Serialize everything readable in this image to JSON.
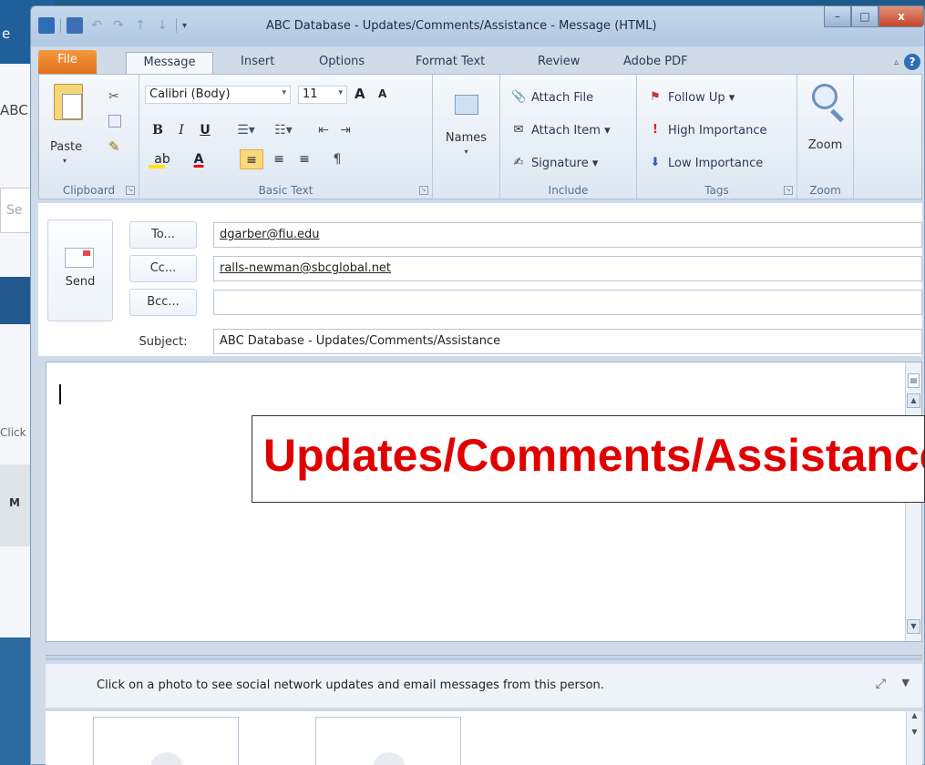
{
  "background_app": {
    "top_text": "e",
    "left_text": "ABC",
    "search_text": "Se",
    "click_text": "Click",
    "tile_text": "M"
  },
  "window": {
    "title": "ABC Database - Updates/Comments/Assistance - Message (HTML)",
    "controls": {
      "minimize": "–",
      "maximize": "□",
      "close": "x"
    }
  },
  "ribbon_tabs": [
    "File",
    "Message",
    "Insert",
    "Options",
    "Format Text",
    "Review",
    "Adobe PDF"
  ],
  "active_tab": "Message",
  "ribbon": {
    "clipboard": {
      "label": "Clipboard",
      "paste": "Paste"
    },
    "basic_text": {
      "label": "Basic Text",
      "font": "Calibri (Body)",
      "size": "11",
      "bold": "B",
      "italic": "I",
      "underline": "U",
      "grow_font": "A",
      "shrink_font": "A"
    },
    "names": {
      "label": "Names"
    },
    "include": {
      "label": "Include",
      "attach_file": "Attach File",
      "attach_item": "Attach Item ▾",
      "signature": "Signature ▾"
    },
    "tags": {
      "label": "Tags",
      "follow_up": "Follow Up ▾",
      "high_importance": "High Importance",
      "low_importance": "Low Importance"
    },
    "zoom": {
      "label": "Zoom",
      "button": "Zoom"
    }
  },
  "message": {
    "send": "Send",
    "to_button": "To...",
    "cc_button": "Cc...",
    "bcc_button": "Bcc...",
    "subject_label": "Subject:",
    "to": "dgarber@fiu.edu",
    "cc": "ralls-newman@sbcglobal.net",
    "bcc": "",
    "subject": "ABC Database - Updates/Comments/Assistance"
  },
  "overlay": {
    "text": "Updates/Comments/Assistance"
  },
  "people_pane": {
    "info": "Click on a photo to see social network updates and email messages from this person."
  },
  "colors": {
    "file_tab": "#e2701b",
    "overlay_text": "#e00000",
    "close_button": "#c4452a"
  }
}
